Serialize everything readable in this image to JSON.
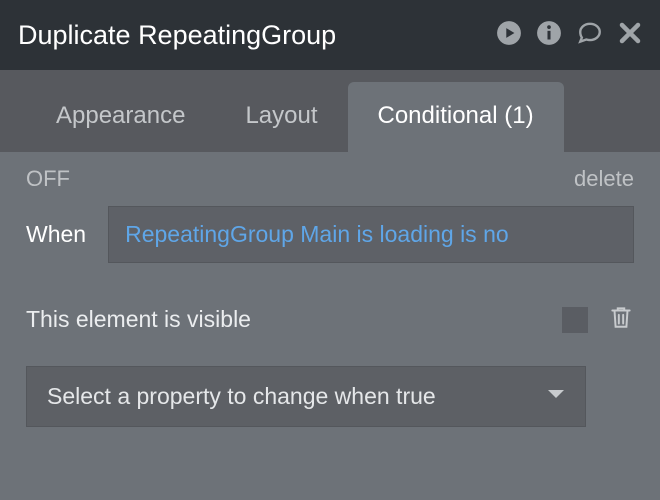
{
  "header": {
    "title": "Duplicate RepeatingGroup"
  },
  "tabs": {
    "appearance": "Appearance",
    "layout": "Layout",
    "conditional": "Conditional (1)"
  },
  "condition": {
    "state": "OFF",
    "delete": "delete",
    "when_label": "When",
    "expression": "RepeatingGroup Main is loading is no",
    "property_label": "This element is visible",
    "dropdown_placeholder": "Select a property to change when true"
  }
}
